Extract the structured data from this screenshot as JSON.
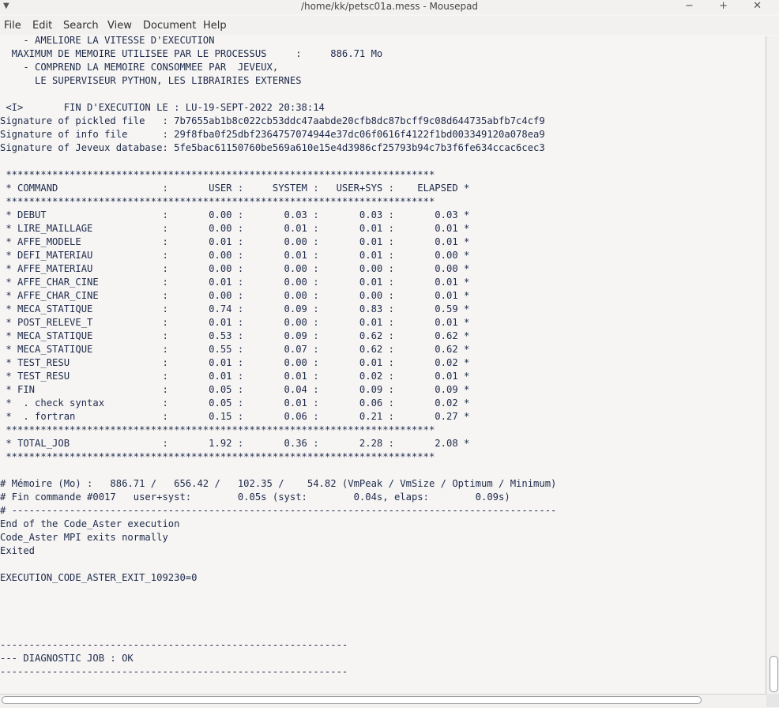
{
  "window": {
    "title": "/home/kk/petsc01a.mess - Mousepad",
    "menu_icon": "chevron-down-icon",
    "controls": [
      "minimize-icon",
      "maximize-icon",
      "close-icon"
    ],
    "controls_text": "− + ✕"
  },
  "menubar": {
    "items": [
      "File",
      "Edit",
      "Search",
      "View",
      "Document",
      "Help"
    ]
  },
  "editor": {
    "content": "    - AMELIORE LA VITESSE D'EXECUTION\n  MAXIMUM DE MEMOIRE UTILISEE PAR LE PROCESSUS     :     886.71 Mo\n    - COMPREND LA MEMOIRE CONSOMMEE PAR  JEVEUX,\n      LE SUPERVISEUR PYTHON, LES LIBRAIRIES EXTERNES\n\n <I>       FIN D'EXECUTION LE : LU-19-SEPT-2022 20:38:14\nSignature of pickled file   : 7b7655ab1b8c022cb53ddc47aabde20cfb8dc87bcff9c08d644735abfb7c4cf9\nSignature of info file      : 29f8fba0f25dbf2364757074944e37dc06f0616f4122f1bd003349120a078ea9\nSignature of Jeveux database: 5fe5bac61150760be569a610e15e4d3986cf25793b94c7b3f6fe634ccac6cec3\n\n **************************************************************************\n * COMMAND                  :       USER :     SYSTEM :   USER+SYS :    ELAPSED *\n **************************************************************************\n * DEBUT                    :       0.00 :       0.03 :       0.03 :       0.03 *\n * LIRE_MAILLAGE            :       0.00 :       0.01 :       0.01 :       0.01 *\n * AFFE_MODELE              :       0.01 :       0.00 :       0.01 :       0.01 *\n * DEFI_MATERIAU            :       0.00 :       0.01 :       0.01 :       0.00 *\n * AFFE_MATERIAU            :       0.00 :       0.00 :       0.00 :       0.00 *\n * AFFE_CHAR_CINE           :       0.01 :       0.00 :       0.01 :       0.01 *\n * AFFE_CHAR_CINE           :       0.00 :       0.00 :       0.00 :       0.01 *\n * MECA_STATIQUE            :       0.74 :       0.09 :       0.83 :       0.59 *\n * POST_RELEVE_T            :       0.01 :       0.00 :       0.01 :       0.01 *\n * MECA_STATIQUE            :       0.53 :       0.09 :       0.62 :       0.62 *\n * MECA_STATIQUE            :       0.55 :       0.07 :       0.62 :       0.62 *\n * TEST_RESU                :       0.01 :       0.00 :       0.01 :       0.02 *\n * TEST_RESU                :       0.01 :       0.01 :       0.02 :       0.01 *\n * FIN                      :       0.05 :       0.04 :       0.09 :       0.09 *\n *  . check syntax          :       0.05 :       0.01 :       0.06 :       0.02 *\n *  . fortran               :       0.15 :       0.06 :       0.21 :       0.27 *\n **************************************************************************\n * TOTAL_JOB                :       1.92 :       0.36 :       2.28 :       2.08 *\n **************************************************************************\n\n# Mémoire (Mo) :   886.71 /   656.42 /   102.35 /    54.82 (VmPeak / VmSize / Optimum / Minimum)\n# Fin commande #0017   user+syst:        0.05s (syst:        0.04s, elaps:        0.09s)\n# ----------------------------------------------------------------------------------------------\nEnd of the Code_Aster execution\nCode_Aster MPI exits normally\nExited\n\nEXECUTION_CODE_ASTER_EXIT_109230=0\n\n\n\n\n------------------------------------------------------------\n--- DIAGNOSTIC JOB : OK\n------------------------------------------------------------"
  }
}
